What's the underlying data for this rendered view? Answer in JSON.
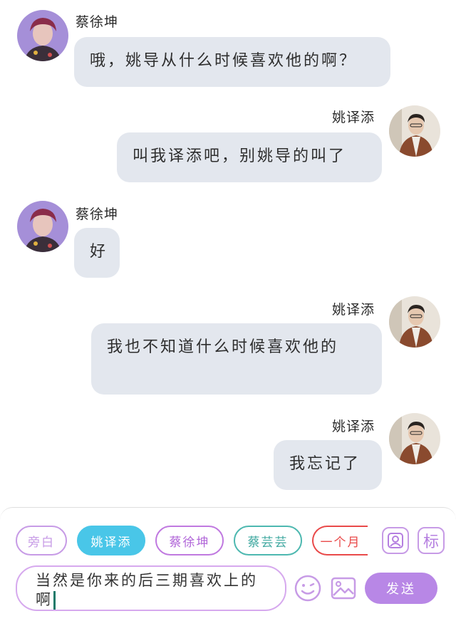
{
  "messages": [
    {
      "sender": "蔡徐坤",
      "text": "哦，姚导从什么时候喜欢他的啊？"
    },
    {
      "sender": "姚译添",
      "text": "叫我译添吧，别姚导的叫了"
    },
    {
      "sender": "蔡徐坤",
      "text": "好"
    },
    {
      "sender": "姚译添",
      "text": "我也不知道什么时候喜欢他的"
    },
    {
      "sender": "姚译添",
      "text": "我忘记了"
    }
  ],
  "roles": [
    {
      "label": "旁白",
      "color": "#c79be6",
      "selected": false
    },
    {
      "label": "姚译添",
      "color": "#49c6e8",
      "selected": true
    },
    {
      "label": "蔡徐坤",
      "color": "#c079e0",
      "selected": false
    },
    {
      "label": "蔡芸芸",
      "color": "#4db8b0",
      "selected": false
    },
    {
      "label": "一个月",
      "color": "#e94a4a",
      "selected": false
    }
  ],
  "toolbar": {
    "avatar_icon": "contact-card-icon",
    "label_button": "标",
    "emoji_icon": "smiley-icon",
    "image_icon": "image-icon",
    "send_label": "发送"
  },
  "input": {
    "value": "当然是你来的后三期喜欢上的啊"
  },
  "colors": {
    "bubble": "#e3e7ee",
    "accent": "#b887e6"
  }
}
